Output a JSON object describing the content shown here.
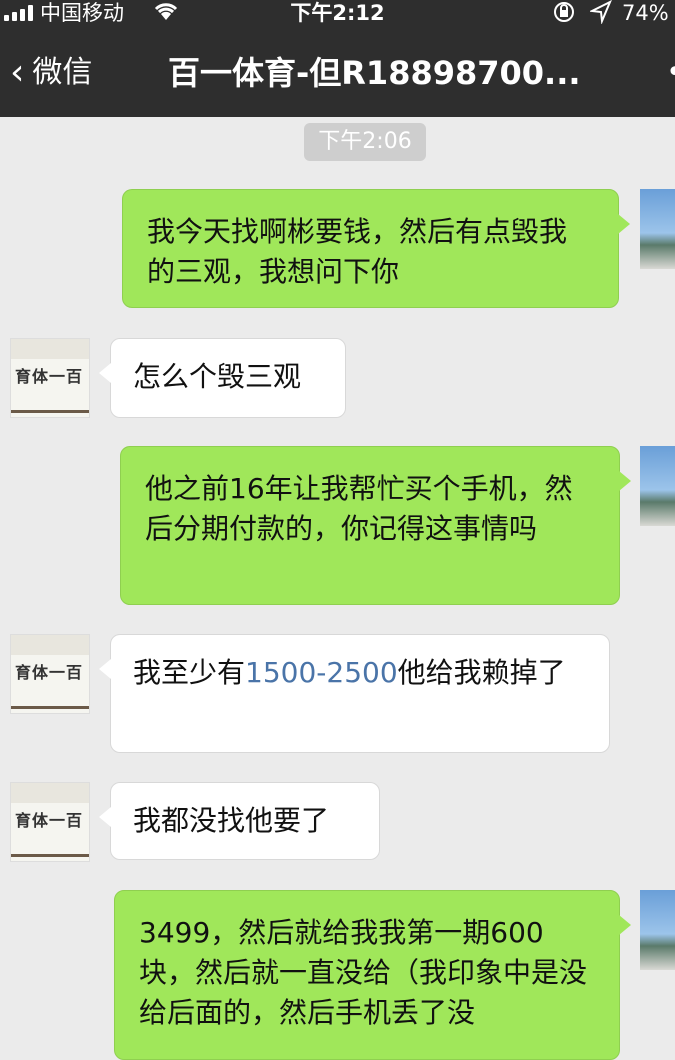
{
  "status_bar": {
    "carrier": "中国移动",
    "time": "下午2:12",
    "battery": "74%"
  },
  "nav": {
    "back_label": "微信",
    "title": "百一体育-但R18898700...",
    "more": "•"
  },
  "chat": {
    "timestamp": "下午2:06",
    "other_avatar_sign": "育体一百",
    "messages": [
      {
        "from": "self",
        "text": "我今天找啊彬要钱，然后有点毁我的三观，我想问下你"
      },
      {
        "from": "other",
        "text": "怎么个毁三观"
      },
      {
        "from": "self",
        "text": "他之前16年让我帮忙买个手机，然后分期付款的，你记得这事情吗"
      },
      {
        "from": "other",
        "text_before": "我至少有",
        "link": "1500-2500",
        "text_after": "他给我赖掉了"
      },
      {
        "from": "other",
        "text": "我都没找他要了"
      },
      {
        "from": "self",
        "text": "3499，然后就给我我第一期600块，然后就一直没给（我印象中是没给后面的，然后手机丢了没"
      }
    ]
  },
  "colors": {
    "self_bubble": "#a0e75a",
    "other_bubble": "#ffffff",
    "nav_bg": "#2e2e2e",
    "chat_bg": "#ebebeb",
    "link": "#4a74a8"
  }
}
